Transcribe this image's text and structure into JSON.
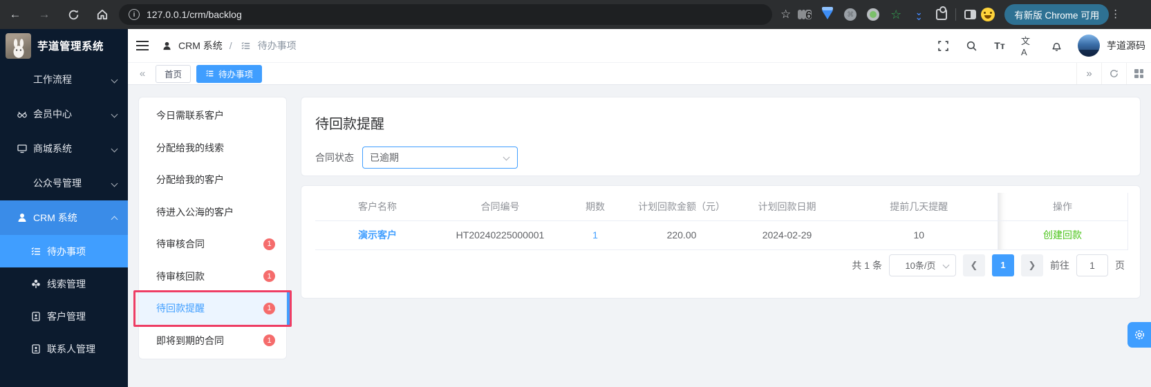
{
  "browser": {
    "url": "127.0.0.1/crm/backlog",
    "update_button": "有新版 Chrome 可用",
    "extension_badge": "6"
  },
  "app": {
    "title": "芋道管理系统"
  },
  "sidebar": {
    "items": [
      {
        "label": "工作流程"
      },
      {
        "label": "会员中心"
      },
      {
        "label": "商城系统"
      },
      {
        "label": "公众号管理"
      },
      {
        "label": "CRM 系统"
      },
      {
        "label": "待办事项"
      },
      {
        "label": "线索管理"
      },
      {
        "label": "客户管理"
      },
      {
        "label": "联系人管理"
      }
    ]
  },
  "header": {
    "breadcrumb": {
      "section": "CRM 系统",
      "separator": "/",
      "page": "待办事项"
    },
    "username": "芋道源码"
  },
  "tabs": {
    "items": [
      {
        "label": "首页"
      },
      {
        "label": "待办事项"
      }
    ]
  },
  "todo_panel": {
    "items": [
      {
        "label": "今日需联系客户",
        "badge": ""
      },
      {
        "label": "分配给我的线索",
        "badge": ""
      },
      {
        "label": "分配给我的客户",
        "badge": ""
      },
      {
        "label": "待进入公海的客户",
        "badge": ""
      },
      {
        "label": "待审核合同",
        "badge": "1"
      },
      {
        "label": "待审核回款",
        "badge": "1"
      },
      {
        "label": "待回款提醒",
        "badge": "1"
      },
      {
        "label": "即将到期的合同",
        "badge": "1"
      }
    ]
  },
  "main": {
    "title": "待回款提醒",
    "filter": {
      "label": "合同状态",
      "value": "已逾期"
    },
    "table": {
      "columns": [
        "客户名称",
        "合同编号",
        "期数",
        "计划回款金额（元）",
        "计划回款日期",
        "提前几天提醒",
        "操作"
      ],
      "rows": [
        {
          "customer": "演示客户",
          "contract_no": "HT20240225000001",
          "periods": "1",
          "amount": "220.00",
          "date": "2024-02-29",
          "remind_days": "10",
          "action": "创建回款"
        }
      ]
    },
    "pagination": {
      "total": "共 1 条",
      "page_size": "10条/页",
      "current_page": "1",
      "goto_label": "前往",
      "goto_value": "1",
      "page_unit": "页"
    }
  },
  "colors": {
    "accent": "#409eff",
    "success": "#4bc41a",
    "danger": "#f56c6c",
    "annotation_highlight": "#ee3d64",
    "sidebar_bg": "#0c1b2e"
  }
}
